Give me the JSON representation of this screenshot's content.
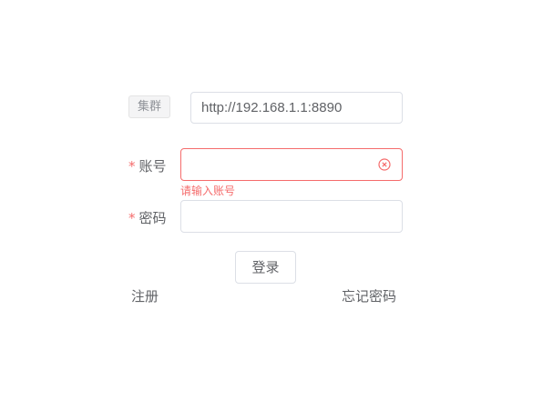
{
  "cluster": {
    "tag_label": "集群",
    "url_value": "http://192.168.1.1:8890"
  },
  "form": {
    "required_mark": "*",
    "account_label": "账号",
    "account_value": "",
    "account_error": "请输入账号",
    "password_label": "密码",
    "password_value": ""
  },
  "actions": {
    "login_label": "登录",
    "register_label": "注册",
    "forgot_label": "忘记密码"
  },
  "colors": {
    "error": "#f56c6c",
    "border": "#dcdfe6",
    "text": "#606266",
    "tag_bg": "#f4f4f5"
  },
  "icons": {
    "clear": "circle-close-icon"
  }
}
